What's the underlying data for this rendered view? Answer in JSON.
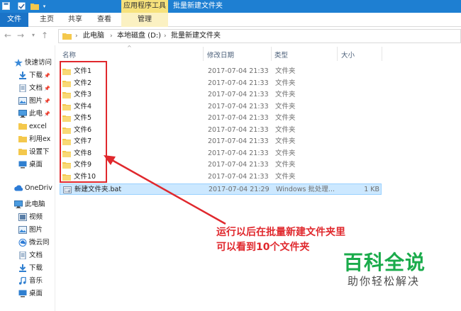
{
  "titlebar": {
    "context_tab": "应用程序工具",
    "window_title": "批量新建文件夹",
    "quick_access_icons": [
      "save-icon",
      "folder-icon",
      "dropdown-icon"
    ]
  },
  "ribbon": {
    "tabs": [
      "文件",
      "主页",
      "共享",
      "查看",
      "管理"
    ]
  },
  "address": {
    "crumbs": [
      "此电脑",
      "本地磁盘 (D:)",
      "批量新建文件夹"
    ]
  },
  "navpane": {
    "items": [
      {
        "label": "快速访问",
        "icon": "star-icon"
      },
      {
        "label": "下载",
        "icon": "download-icon",
        "pinned": true
      },
      {
        "label": "文档",
        "icon": "document-icon",
        "pinned": true
      },
      {
        "label": "图片",
        "icon": "picture-icon",
        "pinned": true
      },
      {
        "label": "此电",
        "icon": "computer-icon",
        "pinned": true
      },
      {
        "label": "excel",
        "icon": "folder-icon"
      },
      {
        "label": "利用ex",
        "icon": "folder-icon"
      },
      {
        "label": "设置下",
        "icon": "folder-icon"
      },
      {
        "label": "桌面",
        "icon": "desktop-icon"
      },
      {
        "label": "OneDriv",
        "icon": "cloud-icon"
      },
      {
        "label": "此电脑",
        "icon": "computer-icon"
      },
      {
        "label": "视频",
        "icon": "video-icon"
      },
      {
        "label": "图片",
        "icon": "picture-icon"
      },
      {
        "label": "微云同",
        "icon": "cloud-sync-icon"
      },
      {
        "label": "文档",
        "icon": "document-icon"
      },
      {
        "label": "下载",
        "icon": "download-icon"
      },
      {
        "label": "音乐",
        "icon": "music-icon"
      },
      {
        "label": "桌面",
        "icon": "desktop-icon"
      }
    ]
  },
  "list": {
    "columns": {
      "name": "名称",
      "modified": "修改日期",
      "type": "类型",
      "size": "大小"
    },
    "rows": [
      {
        "name": "文件1",
        "date": "2017-07-04 21:33",
        "type": "文件夹",
        "size": ""
      },
      {
        "name": "文件2",
        "date": "2017-07-04 21:33",
        "type": "文件夹",
        "size": ""
      },
      {
        "name": "文件3",
        "date": "2017-07-04 21:33",
        "type": "文件夹",
        "size": ""
      },
      {
        "name": "文件4",
        "date": "2017-07-04 21:33",
        "type": "文件夹",
        "size": ""
      },
      {
        "name": "文件5",
        "date": "2017-07-04 21:33",
        "type": "文件夹",
        "size": ""
      },
      {
        "name": "文件6",
        "date": "2017-07-04 21:33",
        "type": "文件夹",
        "size": ""
      },
      {
        "name": "文件7",
        "date": "2017-07-04 21:33",
        "type": "文件夹",
        "size": ""
      },
      {
        "name": "文件8",
        "date": "2017-07-04 21:33",
        "type": "文件夹",
        "size": ""
      },
      {
        "name": "文件9",
        "date": "2017-07-04 21:33",
        "type": "文件夹",
        "size": ""
      },
      {
        "name": "文件10",
        "date": "2017-07-04 21:33",
        "type": "文件夹",
        "size": ""
      },
      {
        "name": "新建文件夹.bat",
        "date": "2017-07-04 21:29",
        "type": "Windows 批处理...",
        "size": "1 KB",
        "selected": true
      }
    ]
  },
  "annotation": {
    "line1": "运行以后在批量新建文件夹里",
    "line2": "可以看到10个文件夹"
  },
  "watermark": {
    "title": "百科全说",
    "subtitle": "助你轻松解决"
  },
  "colors": {
    "titlebar": "#1e7fd2",
    "context_tab": "#f7e27c",
    "selection": "#cce8ff",
    "annotation_red": "#e0282d",
    "watermark_green": "#1aab4b",
    "folder_yellow": "#f4c84c"
  }
}
